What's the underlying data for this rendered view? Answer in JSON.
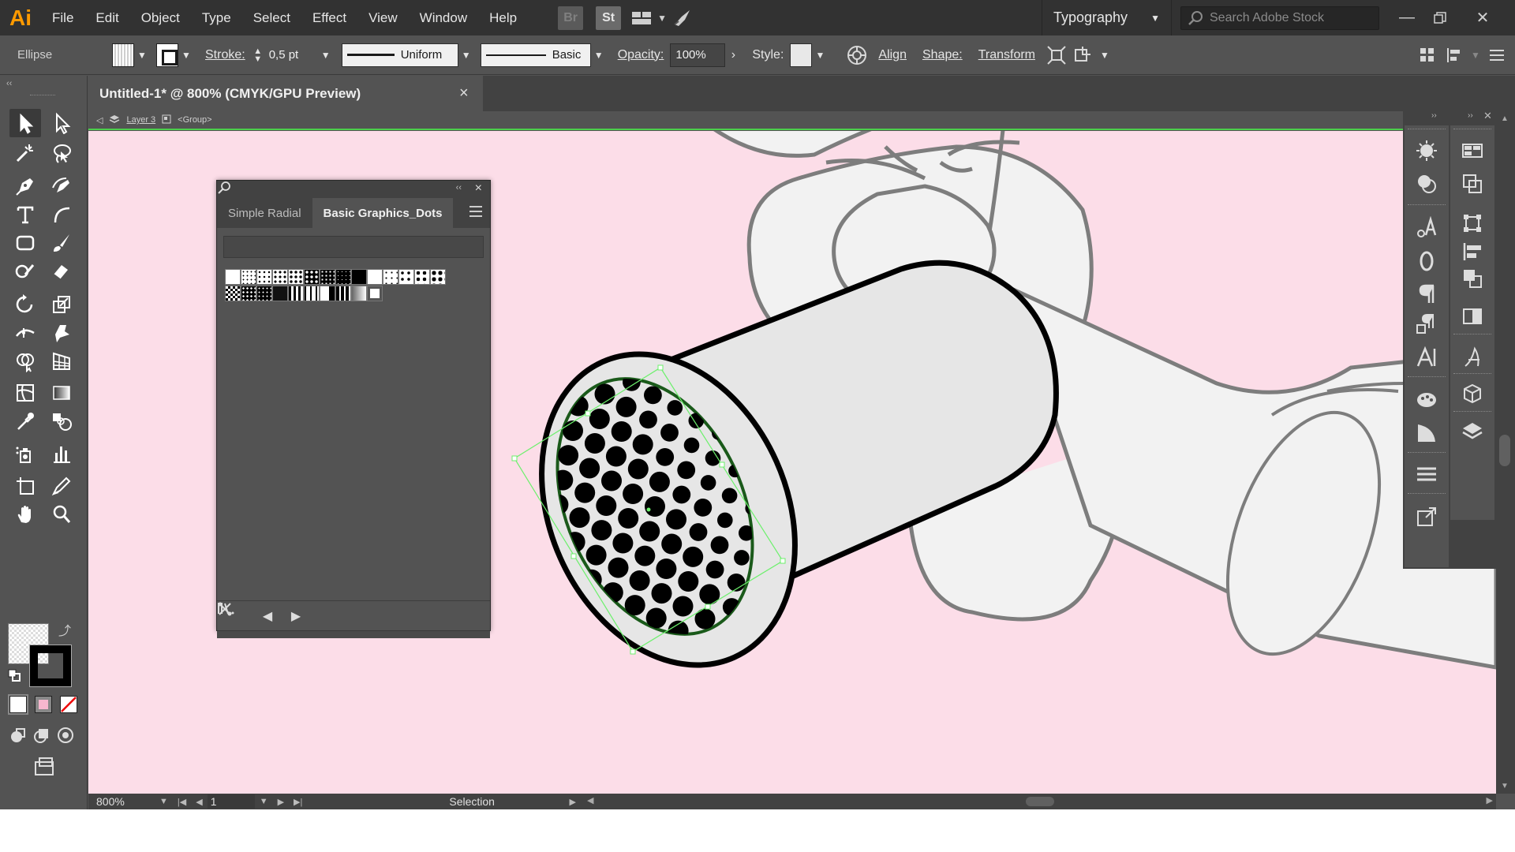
{
  "app": {
    "logo": "Ai"
  },
  "menu": [
    "File",
    "Edit",
    "Object",
    "Type",
    "Select",
    "Effect",
    "View",
    "Window",
    "Help"
  ],
  "menubar_apps": {
    "bridge": "Br",
    "stock": "St"
  },
  "workspace": {
    "label": "Typography"
  },
  "search_stock": {
    "placeholder": "Search Adobe Stock"
  },
  "control_bar": {
    "object_type": "Ellipse",
    "stroke_label": "Stroke:",
    "stroke_weight": "0,5 pt",
    "variable_width": "Uniform",
    "brush": "Basic",
    "opacity_label": "Opacity:",
    "opacity_value": "100%",
    "style_label": "Style:",
    "align": "Align",
    "shape": "Shape:",
    "transform": "Transform"
  },
  "document": {
    "tab_title": "Untitled-1* @ 800% (CMYK/GPU Preview)",
    "close": "×"
  },
  "breadcrumb": {
    "layer": "Layer 3",
    "group": "<Group>"
  },
  "swatch_panel": {
    "tabs": [
      "Simple Radial",
      "Basic Graphics_Dots"
    ],
    "active_tab": 1,
    "close": "×"
  },
  "status_bar": {
    "zoom": "800%",
    "page": "1",
    "mode": "Selection"
  },
  "colors": {
    "canvas": "#fcdde8",
    "ui_dark": "#323232",
    "ui_mid": "#535353",
    "accent_orange": "#ff9a00",
    "selection_green": "#4ccf4c"
  }
}
